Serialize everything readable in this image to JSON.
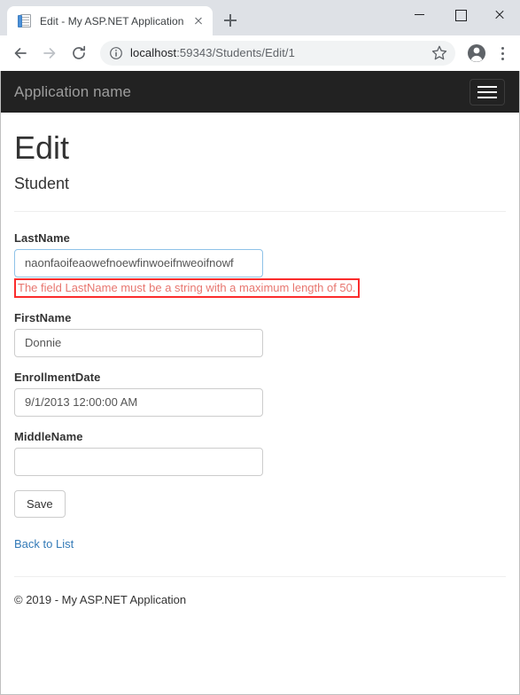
{
  "browser": {
    "tab": {
      "title": "Edit - My ASP.NET Application",
      "favicon": "document-icon",
      "close_label": "×"
    },
    "new_tab_label": "+",
    "window_controls": {
      "minimize": "—",
      "maximize": "□",
      "close": "×"
    },
    "toolbar": {
      "back": "back-arrow-icon",
      "forward": "forward-arrow-icon",
      "reload": "reload-icon",
      "site_info": "info-circle-icon",
      "url_host": "localhost",
      "url_rest": ":59343/Students/Edit/1",
      "url_full": "localhost:59343/Students/Edit/1",
      "bookmark": "star-icon",
      "profile": "profile-avatar-icon",
      "menu": "three-dot-menu-icon"
    }
  },
  "page": {
    "navbar": {
      "brand": "Application name",
      "toggle": "hamburger-menu-icon"
    },
    "title": "Edit",
    "subtitle": "Student",
    "form": {
      "fields": [
        {
          "label": "LastName",
          "value": "naonfaoifeaowefnoewfinwoeifnweoifnowf",
          "placeholder": "",
          "error": "The field LastName must be a string with a maximum length of 50.",
          "has_error": true
        },
        {
          "label": "FirstName",
          "value": "Donnie",
          "placeholder": "",
          "error": "",
          "has_error": false
        },
        {
          "label": "EnrollmentDate",
          "value": "9/1/2013 12:00:00 AM",
          "placeholder": "",
          "error": "",
          "has_error": false
        },
        {
          "label": "MiddleName",
          "value": "",
          "placeholder": "",
          "error": "",
          "has_error": false
        }
      ],
      "submit_label": "Save"
    },
    "back_link": "Back to List",
    "footer": "© 2019 - My ASP.NET Application"
  },
  "colors": {
    "navbar_bg": "#222222",
    "brand_text": "#9d9d9d",
    "error_text": "#e8766f",
    "error_border": "#fb2c2c",
    "link": "#337ab7",
    "input_border": "#cccccc",
    "focus_border": "#8ec2e8"
  }
}
